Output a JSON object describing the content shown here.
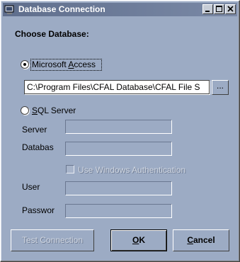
{
  "window": {
    "title": "Database Connection"
  },
  "heading": "Choose Database:",
  "access": {
    "pre": "Microsoft ",
    "accel": "A",
    "post": "ccess",
    "path_value": "C:\\Program Files\\CFAL Database\\CFAL File S",
    "browse_label": "..."
  },
  "sql": {
    "accel": "S",
    "post": "QL Server"
  },
  "fields": {
    "server_label": "Server",
    "database_label": "Databas",
    "windows_auth_label": "Use Windows Authentication",
    "user_label": "User",
    "password_label": "Passwor"
  },
  "buttons": {
    "test": "Test Connection",
    "ok_accel": "O",
    "ok_post": "K",
    "cancel_accel": "C",
    "cancel_post": "ancel"
  },
  "colors": {
    "background": "#9cabc4",
    "titlebar": "#5f6e8c"
  }
}
